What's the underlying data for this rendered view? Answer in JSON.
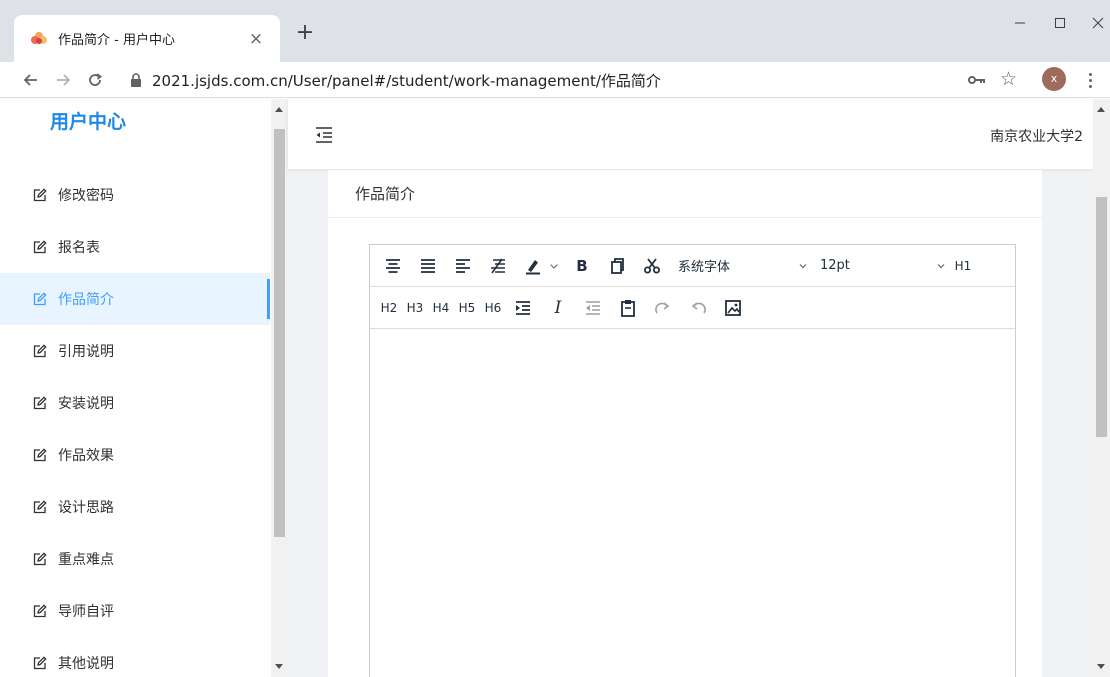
{
  "browser": {
    "tab_title": "作品简介 - 用户中心",
    "tab_close": "×",
    "new_tab": "+",
    "url": "2021.jsjds.com.cn/User/panel#/student/work-management/作品简介",
    "avatar_letter": "x"
  },
  "sidebar": {
    "title": "用户中心",
    "items": [
      {
        "label": "修改密码",
        "active": false
      },
      {
        "label": "报名表",
        "active": false
      },
      {
        "label": "作品简介",
        "active": true
      },
      {
        "label": "引用说明",
        "active": false
      },
      {
        "label": "安装说明",
        "active": false
      },
      {
        "label": "作品效果",
        "active": false
      },
      {
        "label": "设计思路",
        "active": false
      },
      {
        "label": "重点难点",
        "active": false
      },
      {
        "label": "导师自评",
        "active": false
      },
      {
        "label": "其他说明",
        "active": false
      }
    ]
  },
  "header": {
    "user_name": "南京农业大学2"
  },
  "card": {
    "title": "作品简介"
  },
  "editor": {
    "bold_label": "B",
    "italic_label": "I",
    "font_family": "系统字体",
    "font_size": "12pt",
    "headings": [
      "H1",
      "H2",
      "H3",
      "H4",
      "H5",
      "H6"
    ]
  },
  "colors": {
    "accent": "#409eff",
    "sidebar_title": "#1e88e5",
    "active_bg": "#e8f4ff",
    "page_bg": "#f0f2f5"
  },
  "icons": {
    "menu_item": "edit-icon",
    "favicon": "sunflower-icon"
  }
}
